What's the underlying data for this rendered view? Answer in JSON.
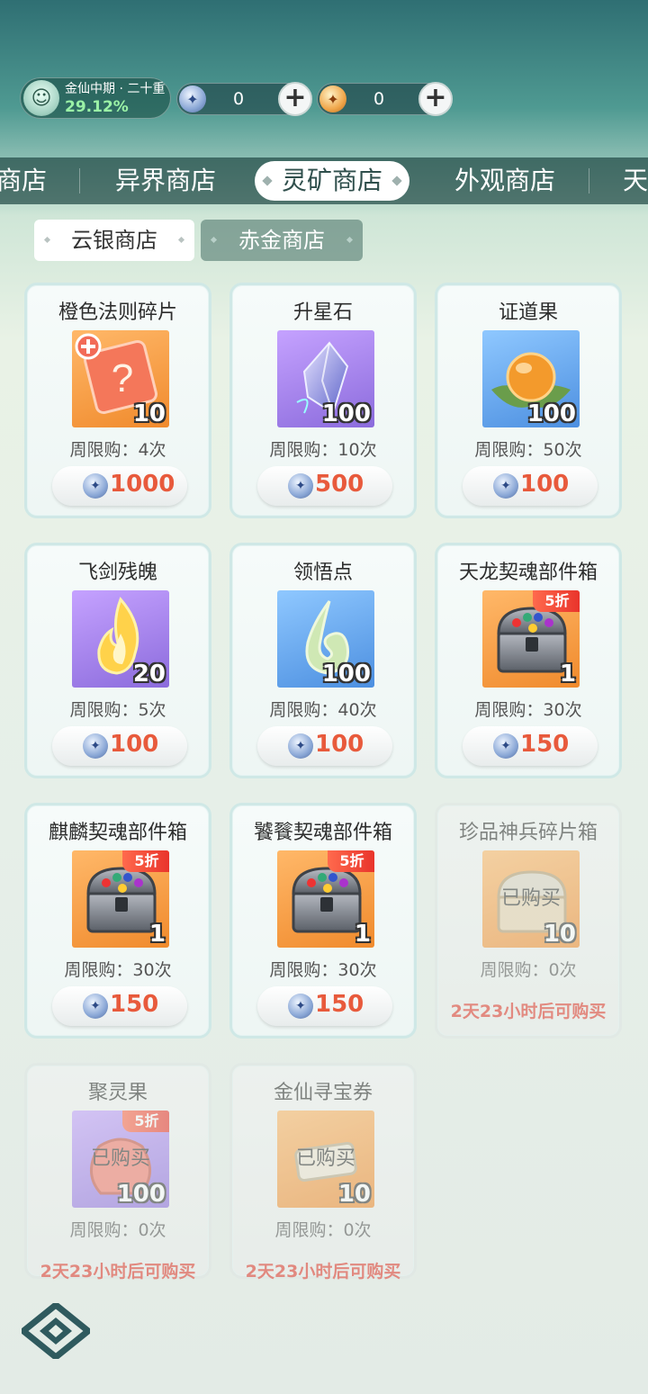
{
  "status": {
    "realm_name": "金仙中期 · 二十重",
    "realm_progress": "29.12%",
    "currencies": [
      {
        "icon": "silver-coin-icon",
        "value": "0"
      },
      {
        "icon": "gold-coin-icon",
        "value": "0"
      }
    ]
  },
  "tabs": [
    "商店",
    "异界商店",
    "灵矿商店",
    "外观商店",
    "天"
  ],
  "active_tab": "灵矿商店",
  "subtabs": [
    "云银商店",
    "赤金商店"
  ],
  "items": [
    {
      "name": "橙色法则碎片",
      "qty": "10",
      "limit": "周限购：4次",
      "price": "1000",
      "image": "orange",
      "discount": "",
      "sold": "",
      "restock": ""
    },
    {
      "name": "升星石",
      "qty": "100",
      "limit": "周限购：10次",
      "price": "500",
      "image": "purple",
      "discount": "",
      "sold": "",
      "restock": ""
    },
    {
      "name": "证道果",
      "qty": "100",
      "limit": "周限购：50次",
      "price": "100",
      "image": "blue",
      "discount": "",
      "sold": "",
      "restock": ""
    },
    {
      "name": "飞剑残魄",
      "qty": "20",
      "limit": "周限购：5次",
      "price": "100",
      "image": "purple",
      "discount": "",
      "sold": "",
      "restock": ""
    },
    {
      "name": "领悟点",
      "qty": "100",
      "limit": "周限购：40次",
      "price": "100",
      "image": "blue",
      "discount": "",
      "sold": "",
      "restock": ""
    },
    {
      "name": "天龙契魂部件箱",
      "qty": "1",
      "limit": "周限购：30次",
      "price": "150",
      "image": "orange",
      "discount": "5折",
      "sold": "",
      "restock": ""
    },
    {
      "name": "麒麟契魂部件箱",
      "qty": "1",
      "limit": "周限购：30次",
      "price": "150",
      "image": "orange",
      "discount": "5折",
      "sold": "",
      "restock": ""
    },
    {
      "name": "饕餮契魂部件箱",
      "qty": "1",
      "limit": "周限购：30次",
      "price": "150",
      "image": "orange",
      "discount": "5折",
      "sold": "",
      "restock": ""
    },
    {
      "name": "珍品神兵碎片箱",
      "qty": "10",
      "limit": "周限购：0次",
      "price": "",
      "image": "orange",
      "discount": "",
      "sold": "已购买",
      "restock": "2天23小时后可购买"
    },
    {
      "name": "聚灵果",
      "qty": "100",
      "limit": "周限购：0次",
      "price": "",
      "image": "purple",
      "discount": "5折",
      "sold": "已购买",
      "restock": "2天23小时后可购买"
    },
    {
      "name": "金仙寻宝券",
      "qty": "10",
      "limit": "周限购：0次",
      "price": "",
      "image": "orange",
      "discount": "",
      "sold": "已购买",
      "restock": "2天23小时后可购买"
    }
  ]
}
